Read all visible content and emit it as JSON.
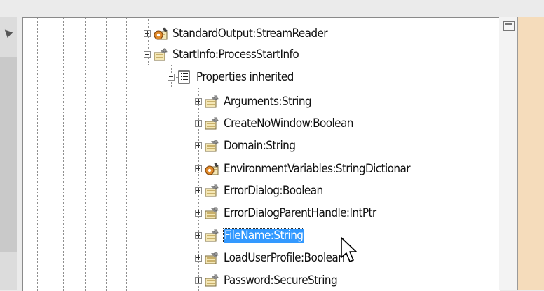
{
  "tree": {
    "nodes": [
      {
        "label": "StandardOutput:StreamReader",
        "icon": "gear-property-icon",
        "state": "collapsed"
      },
      {
        "label": "StartInfo:ProcessStartInfo",
        "icon": "property-icon",
        "state": "expanded"
      },
      {
        "label": "Properties inherited",
        "icon": "document-list-icon",
        "state": "expanded"
      },
      {
        "label": "Arguments:String",
        "icon": "property-icon",
        "state": "collapsed"
      },
      {
        "label": "CreateNoWindow:Boolean",
        "icon": "property-icon",
        "state": "collapsed"
      },
      {
        "label": "Domain:String",
        "icon": "property-icon",
        "state": "collapsed"
      },
      {
        "label": "EnvironmentVariables:StringDictionar",
        "icon": "gear-property-icon",
        "state": "collapsed"
      },
      {
        "label": "ErrorDialog:Boolean",
        "icon": "property-icon",
        "state": "collapsed"
      },
      {
        "label": "ErrorDialogParentHandle:IntPtr",
        "icon": "property-icon",
        "state": "collapsed"
      },
      {
        "label": "FileName:String",
        "icon": "property-icon",
        "state": "collapsed",
        "selected": true
      },
      {
        "label": "LoadUserProfile:Boolean",
        "icon": "property-icon",
        "state": "collapsed"
      },
      {
        "label": "Password:SecureString",
        "icon": "property-icon",
        "state": "collapsed"
      }
    ]
  },
  "colors": {
    "selection": "#3399ff",
    "side_panel": "#f5dcbb"
  }
}
